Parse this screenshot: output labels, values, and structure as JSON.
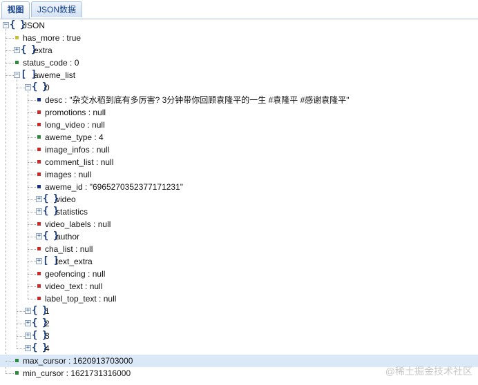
{
  "tabs": [
    {
      "label": "视图",
      "active": true
    },
    {
      "label": "JSON数据",
      "active": false
    }
  ],
  "colors": {
    "boolean": "#c8c038",
    "number": "#2b8a3e",
    "null": "#cc2a2a",
    "string": "#1a2f87",
    "accent": "#15428b"
  },
  "tree": [
    {
      "key": "JSON",
      "kind": "object",
      "expanded": true,
      "depth": 0
    },
    {
      "key": "has_more",
      "value": "true",
      "kind": "boolean",
      "depth": 1
    },
    {
      "key": "extra",
      "kind": "object",
      "expanded": false,
      "depth": 1
    },
    {
      "key": "status_code",
      "value": "0",
      "kind": "number",
      "depth": 1
    },
    {
      "key": "aweme_list",
      "kind": "array",
      "expanded": true,
      "depth": 1
    },
    {
      "key": "0",
      "kind": "object",
      "expanded": true,
      "depth": 2
    },
    {
      "key": "desc",
      "value": "\"杂交水稻到底有多厉害? 3分钟带你回顾袁隆平的一生 #袁隆平 #感谢袁隆平\"",
      "kind": "string",
      "depth": 3
    },
    {
      "key": "promotions",
      "value": "null",
      "kind": "null",
      "depth": 3
    },
    {
      "key": "long_video",
      "value": "null",
      "kind": "null",
      "depth": 3
    },
    {
      "key": "aweme_type",
      "value": "4",
      "kind": "number",
      "depth": 3
    },
    {
      "key": "image_infos",
      "value": "null",
      "kind": "null",
      "depth": 3
    },
    {
      "key": "comment_list",
      "value": "null",
      "kind": "null",
      "depth": 3
    },
    {
      "key": "images",
      "value": "null",
      "kind": "null",
      "depth": 3
    },
    {
      "key": "aweme_id",
      "value": "\"6965270352377171231\"",
      "kind": "string",
      "depth": 3
    },
    {
      "key": "video",
      "kind": "object",
      "expanded": false,
      "depth": 3
    },
    {
      "key": "statistics",
      "kind": "object",
      "expanded": false,
      "depth": 3
    },
    {
      "key": "video_labels",
      "value": "null",
      "kind": "null",
      "depth": 3
    },
    {
      "key": "author",
      "kind": "object",
      "expanded": false,
      "depth": 3
    },
    {
      "key": "cha_list",
      "value": "null",
      "kind": "null",
      "depth": 3
    },
    {
      "key": "text_extra",
      "kind": "array",
      "expanded": false,
      "depth": 3
    },
    {
      "key": "geofencing",
      "value": "null",
      "kind": "null",
      "depth": 3
    },
    {
      "key": "video_text",
      "value": "null",
      "kind": "null",
      "depth": 3
    },
    {
      "key": "label_top_text",
      "value": "null",
      "kind": "null",
      "depth": 3
    },
    {
      "key": "1",
      "kind": "object",
      "expanded": false,
      "depth": 2
    },
    {
      "key": "2",
      "kind": "object",
      "expanded": false,
      "depth": 2
    },
    {
      "key": "3",
      "kind": "object",
      "expanded": false,
      "depth": 2
    },
    {
      "key": "4",
      "kind": "object",
      "expanded": false,
      "depth": 2
    },
    {
      "key": "max_cursor",
      "value": "1620913703000",
      "kind": "number",
      "depth": 1,
      "selected": true
    },
    {
      "key": "min_cursor",
      "value": "1621731316000",
      "kind": "number",
      "depth": 1
    }
  ],
  "watermark": "@稀土掘金技术社区"
}
